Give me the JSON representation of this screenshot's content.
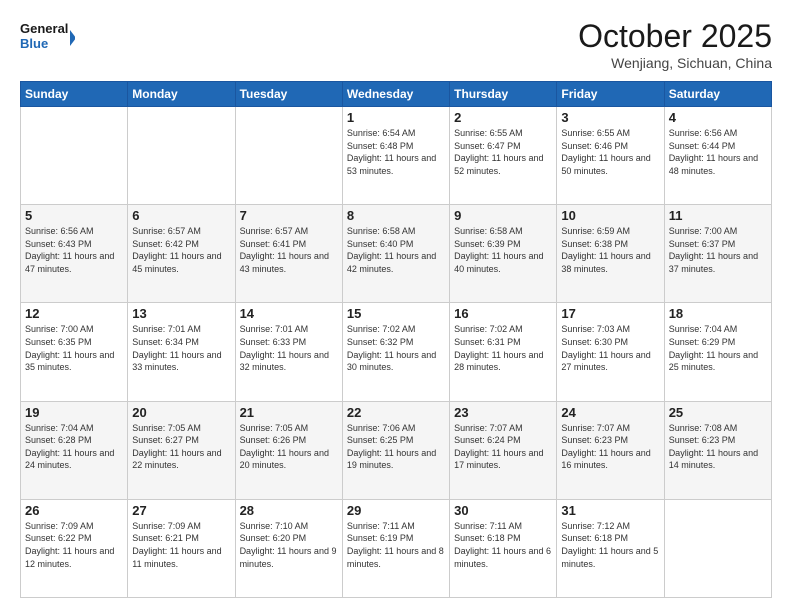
{
  "header": {
    "logo_line1": "General",
    "logo_line2": "Blue",
    "month": "October 2025",
    "location": "Wenjiang, Sichuan, China"
  },
  "weekdays": [
    "Sunday",
    "Monday",
    "Tuesday",
    "Wednesday",
    "Thursday",
    "Friday",
    "Saturday"
  ],
  "weeks": [
    [
      {
        "day": "",
        "text": ""
      },
      {
        "day": "",
        "text": ""
      },
      {
        "day": "",
        "text": ""
      },
      {
        "day": "1",
        "text": "Sunrise: 6:54 AM\nSunset: 6:48 PM\nDaylight: 11 hours\nand 53 minutes."
      },
      {
        "day": "2",
        "text": "Sunrise: 6:55 AM\nSunset: 6:47 PM\nDaylight: 11 hours\nand 52 minutes."
      },
      {
        "day": "3",
        "text": "Sunrise: 6:55 AM\nSunset: 6:46 PM\nDaylight: 11 hours\nand 50 minutes."
      },
      {
        "day": "4",
        "text": "Sunrise: 6:56 AM\nSunset: 6:44 PM\nDaylight: 11 hours\nand 48 minutes."
      }
    ],
    [
      {
        "day": "5",
        "text": "Sunrise: 6:56 AM\nSunset: 6:43 PM\nDaylight: 11 hours\nand 47 minutes."
      },
      {
        "day": "6",
        "text": "Sunrise: 6:57 AM\nSunset: 6:42 PM\nDaylight: 11 hours\nand 45 minutes."
      },
      {
        "day": "7",
        "text": "Sunrise: 6:57 AM\nSunset: 6:41 PM\nDaylight: 11 hours\nand 43 minutes."
      },
      {
        "day": "8",
        "text": "Sunrise: 6:58 AM\nSunset: 6:40 PM\nDaylight: 11 hours\nand 42 minutes."
      },
      {
        "day": "9",
        "text": "Sunrise: 6:58 AM\nSunset: 6:39 PM\nDaylight: 11 hours\nand 40 minutes."
      },
      {
        "day": "10",
        "text": "Sunrise: 6:59 AM\nSunset: 6:38 PM\nDaylight: 11 hours\nand 38 minutes."
      },
      {
        "day": "11",
        "text": "Sunrise: 7:00 AM\nSunset: 6:37 PM\nDaylight: 11 hours\nand 37 minutes."
      }
    ],
    [
      {
        "day": "12",
        "text": "Sunrise: 7:00 AM\nSunset: 6:35 PM\nDaylight: 11 hours\nand 35 minutes."
      },
      {
        "day": "13",
        "text": "Sunrise: 7:01 AM\nSunset: 6:34 PM\nDaylight: 11 hours\nand 33 minutes."
      },
      {
        "day": "14",
        "text": "Sunrise: 7:01 AM\nSunset: 6:33 PM\nDaylight: 11 hours\nand 32 minutes."
      },
      {
        "day": "15",
        "text": "Sunrise: 7:02 AM\nSunset: 6:32 PM\nDaylight: 11 hours\nand 30 minutes."
      },
      {
        "day": "16",
        "text": "Sunrise: 7:02 AM\nSunset: 6:31 PM\nDaylight: 11 hours\nand 28 minutes."
      },
      {
        "day": "17",
        "text": "Sunrise: 7:03 AM\nSunset: 6:30 PM\nDaylight: 11 hours\nand 27 minutes."
      },
      {
        "day": "18",
        "text": "Sunrise: 7:04 AM\nSunset: 6:29 PM\nDaylight: 11 hours\nand 25 minutes."
      }
    ],
    [
      {
        "day": "19",
        "text": "Sunrise: 7:04 AM\nSunset: 6:28 PM\nDaylight: 11 hours\nand 24 minutes."
      },
      {
        "day": "20",
        "text": "Sunrise: 7:05 AM\nSunset: 6:27 PM\nDaylight: 11 hours\nand 22 minutes."
      },
      {
        "day": "21",
        "text": "Sunrise: 7:05 AM\nSunset: 6:26 PM\nDaylight: 11 hours\nand 20 minutes."
      },
      {
        "day": "22",
        "text": "Sunrise: 7:06 AM\nSunset: 6:25 PM\nDaylight: 11 hours\nand 19 minutes."
      },
      {
        "day": "23",
        "text": "Sunrise: 7:07 AM\nSunset: 6:24 PM\nDaylight: 11 hours\nand 17 minutes."
      },
      {
        "day": "24",
        "text": "Sunrise: 7:07 AM\nSunset: 6:23 PM\nDaylight: 11 hours\nand 16 minutes."
      },
      {
        "day": "25",
        "text": "Sunrise: 7:08 AM\nSunset: 6:23 PM\nDaylight: 11 hours\nand 14 minutes."
      }
    ],
    [
      {
        "day": "26",
        "text": "Sunrise: 7:09 AM\nSunset: 6:22 PM\nDaylight: 11 hours\nand 12 minutes."
      },
      {
        "day": "27",
        "text": "Sunrise: 7:09 AM\nSunset: 6:21 PM\nDaylight: 11 hours\nand 11 minutes."
      },
      {
        "day": "28",
        "text": "Sunrise: 7:10 AM\nSunset: 6:20 PM\nDaylight: 11 hours\nand 9 minutes."
      },
      {
        "day": "29",
        "text": "Sunrise: 7:11 AM\nSunset: 6:19 PM\nDaylight: 11 hours\nand 8 minutes."
      },
      {
        "day": "30",
        "text": "Sunrise: 7:11 AM\nSunset: 6:18 PM\nDaylight: 11 hours\nand 6 minutes."
      },
      {
        "day": "31",
        "text": "Sunrise: 7:12 AM\nSunset: 6:18 PM\nDaylight: 11 hours\nand 5 minutes."
      },
      {
        "day": "",
        "text": ""
      }
    ]
  ]
}
